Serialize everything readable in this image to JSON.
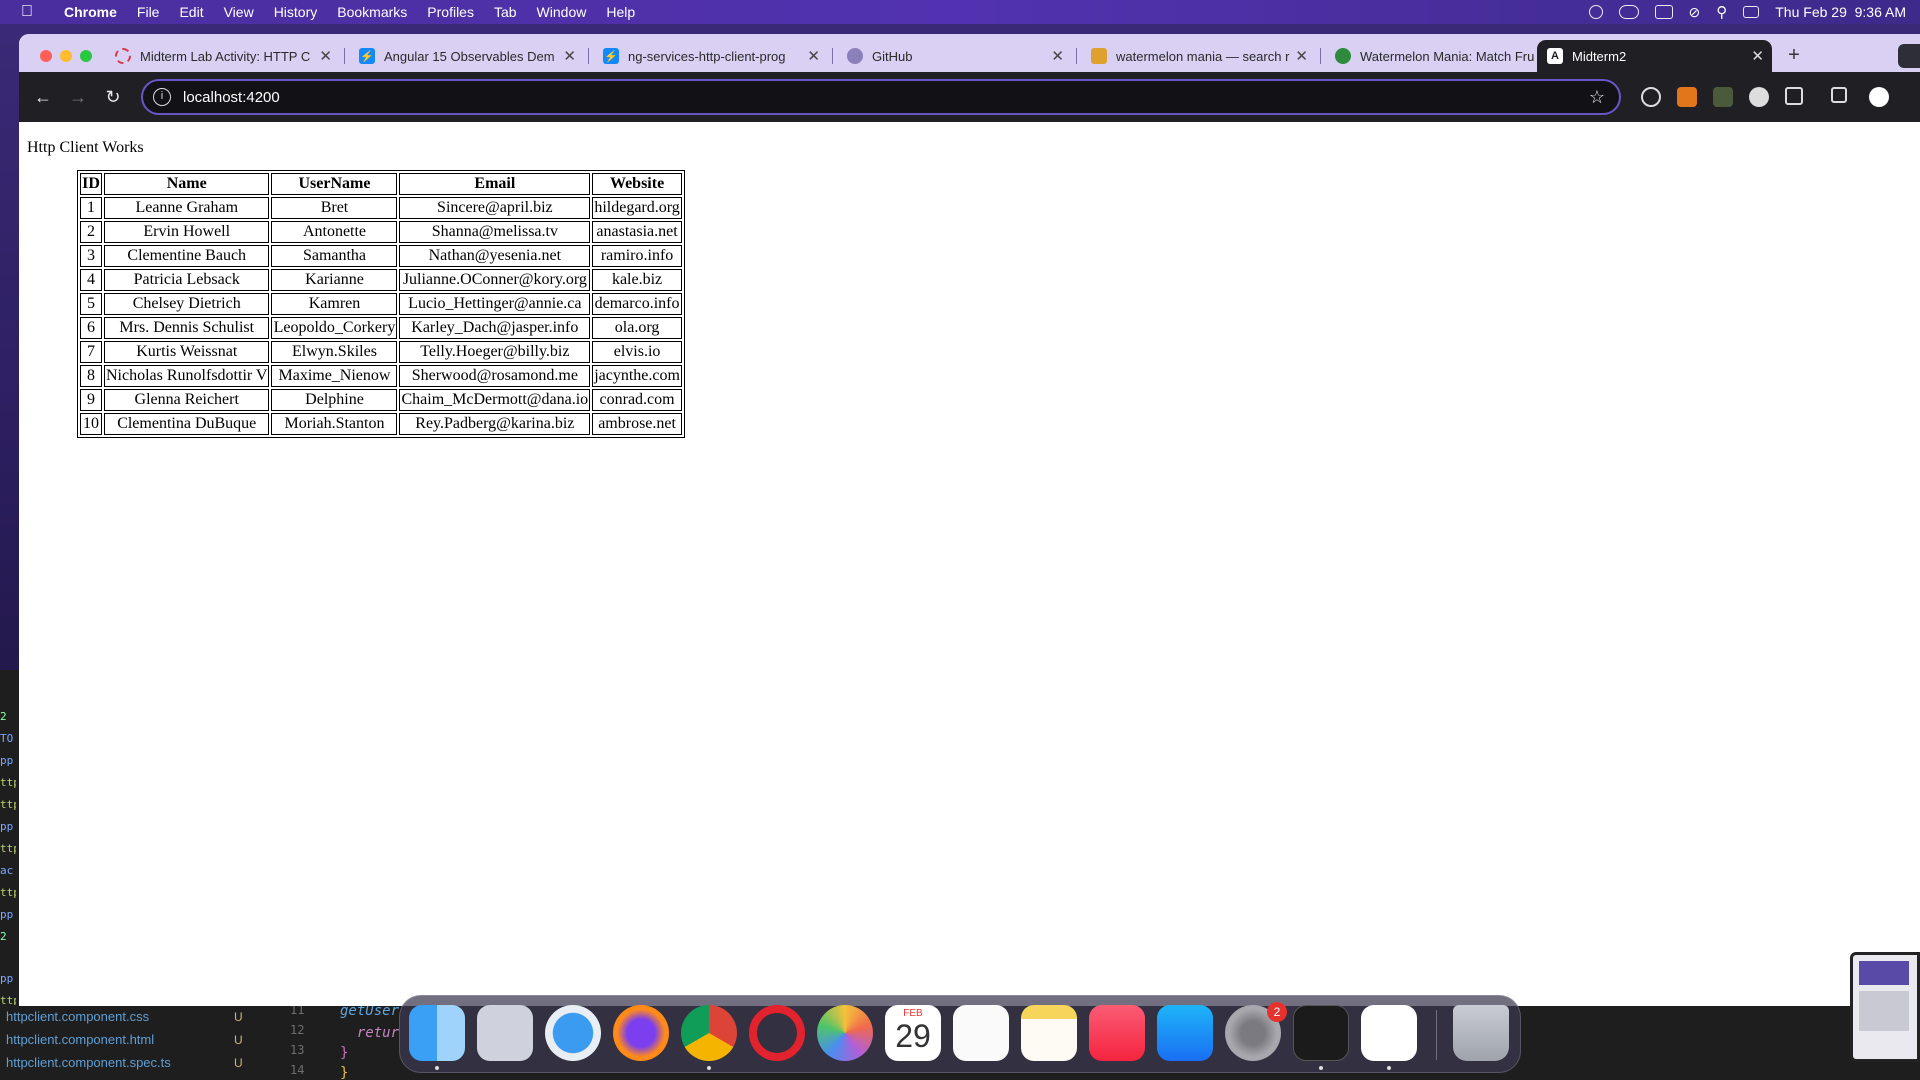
{
  "menubar": {
    "app_name": "Chrome",
    "items": [
      "File",
      "Edit",
      "View",
      "History",
      "Bookmarks",
      "Profiles",
      "Tab",
      "Window",
      "Help"
    ],
    "clock": "Thu Feb 29  9:36 AM",
    "status_icons": [
      "creative-cloud-icon",
      "weather-icon",
      "display-icon",
      "wifi-off-icon",
      "search-icon",
      "control-center-icon"
    ]
  },
  "tabs": [
    {
      "title": "Midterm Lab Activity: HTTP C",
      "favicon": "loading-ring-icon",
      "color": "#d93b4a"
    },
    {
      "title": "Angular 15 Observables Dem",
      "favicon": "stackblitz-icon",
      "color": "#1389fd"
    },
    {
      "title": "ng-services-http-client-prog",
      "favicon": "stackblitz-icon",
      "color": "#1389fd"
    },
    {
      "title": "GitHub",
      "favicon": "github-icon",
      "color": "#6a5fa0"
    },
    {
      "title": "watermelon mania — search r",
      "favicon": "game-icon",
      "color": "#7a3a1a"
    },
    {
      "title": "Watermelon Mania: Match Fru",
      "favicon": "watermelon-icon",
      "color": "#2e8b3e"
    },
    {
      "title": "Midterm2",
      "favicon": "angular-icon",
      "color": "#1f1f24",
      "active": true
    }
  ],
  "address_bar": {
    "url": "localhost:4200"
  },
  "page": {
    "heading": "Http Client Works",
    "table": {
      "headers": [
        "ID",
        "Name",
        "UserName",
        "Email",
        "Website"
      ],
      "rows": [
        [
          "1",
          "Leanne Graham",
          "Bret",
          "Sincere@april.biz",
          "hildegard.org"
        ],
        [
          "2",
          "Ervin Howell",
          "Antonette",
          "Shanna@melissa.tv",
          "anastasia.net"
        ],
        [
          "3",
          "Clementine Bauch",
          "Samantha",
          "Nathan@yesenia.net",
          "ramiro.info"
        ],
        [
          "4",
          "Patricia Lebsack",
          "Karianne",
          "Julianne.OConner@kory.org",
          "kale.biz"
        ],
        [
          "5",
          "Chelsey Dietrich",
          "Kamren",
          "Lucio_Hettinger@annie.ca",
          "demarco.info"
        ],
        [
          "6",
          "Mrs. Dennis Schulist",
          "Leopoldo_Corkery",
          "Karley_Dach@jasper.info",
          "ola.org"
        ],
        [
          "7",
          "Kurtis Weissnat",
          "Elwyn.Skiles",
          "Telly.Hoeger@billy.biz",
          "elvis.io"
        ],
        [
          "8",
          "Nicholas Runolfsdottir V",
          "Maxime_Nienow",
          "Sherwood@rosamond.me",
          "jacynthe.com"
        ],
        [
          "9",
          "Glenna Reichert",
          "Delphine",
          "Chaim_McDermott@dana.io",
          "conrad.com"
        ],
        [
          "10",
          "Clementina DuBuque",
          "Moriah.Stanton",
          "Rey.Padberg@karina.biz",
          "ambrose.net"
        ]
      ]
    }
  },
  "editor": {
    "files": [
      {
        "name": "httpclient.component.css",
        "status": "U"
      },
      {
        "name": "httpclient.component.html",
        "status": "U"
      },
      {
        "name": "httpclient.component.spec.ts",
        "status": "U"
      }
    ],
    "line_numbers": [
      "11",
      "12",
      "13",
      "14"
    ],
    "code_lines": [
      "getUser",
      "  retur",
      "}",
      "}"
    ]
  },
  "calendar": {
    "month": "FEB",
    "day": "29"
  },
  "dock": {
    "apps": [
      "finder-icon",
      "launchpad-icon",
      "safari-icon",
      "firefox-icon",
      "chrome-icon",
      "opera-icon",
      "photos-icon",
      "calendar-icon",
      "reminders-icon",
      "notes-icon",
      "music-icon",
      "app-store-icon",
      "system-settings-icon",
      "terminal-icon",
      "vscode-icon",
      "trash-icon"
    ],
    "settings_badge": "2"
  }
}
